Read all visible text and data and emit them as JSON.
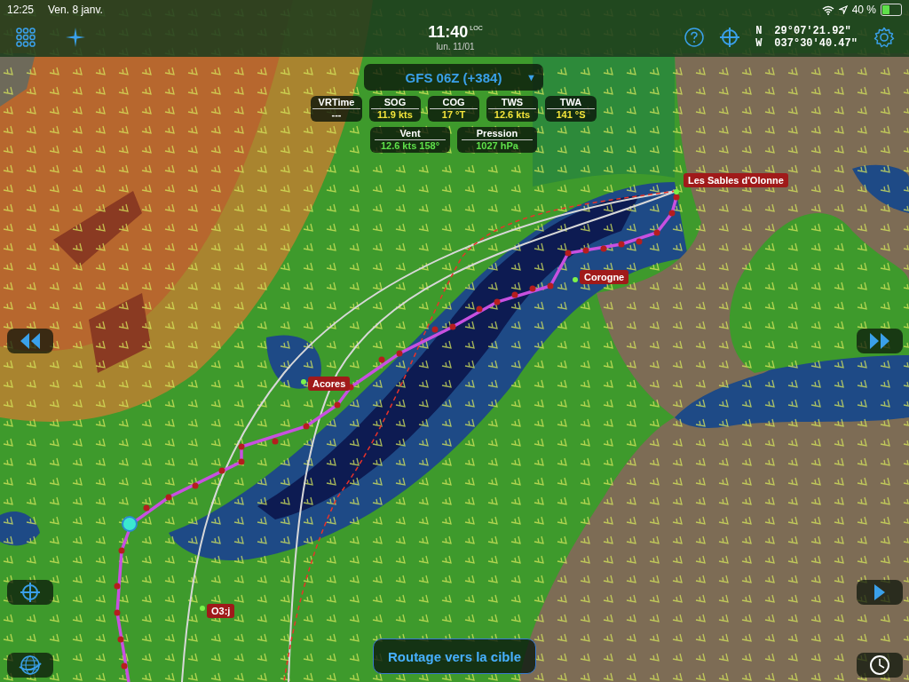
{
  "status_bar": {
    "time": "12:25",
    "date": "Ven. 8 janv.",
    "battery": "40 %"
  },
  "toolbar": {
    "time": "11:40",
    "time_suffix": "LOC",
    "date": "lun. 11/01",
    "position": [
      {
        "hemisphere": "N",
        "value": "29°07'21.92\""
      },
      {
        "hemisphere": "W",
        "value": "037°30'40.47\""
      }
    ]
  },
  "model_selector": {
    "label": "GFS 06Z (+384)",
    "caret": "▼"
  },
  "instruments": [
    [
      {
        "label": "VRTime",
        "value": "---",
        "color": "#ffffff"
      },
      {
        "label": "SOG",
        "value": "11.9 kts",
        "color": "#f2e43a"
      },
      {
        "label": "COG",
        "value": "17 °T",
        "color": "#f2e43a"
      },
      {
        "label": "TWS",
        "value": "12.6 kts",
        "color": "#f2e43a"
      },
      {
        "label": "TWA",
        "value": "141 °S",
        "color": "#f2e43a"
      }
    ],
    [
      {
        "label": "Vent",
        "value": "12.6 kts 158°",
        "color": "#5fe04a"
      },
      {
        "label": "Pression",
        "value": "1027 hPa",
        "color": "#5fe04a"
      }
    ]
  ],
  "places": [
    {
      "label": "Les Sables d'Olonne"
    },
    {
      "label": "Corogne"
    },
    {
      "label": "Acores"
    },
    {
      "label": "O3:j"
    }
  ],
  "route_button": {
    "label": "Routage vers la cible"
  }
}
